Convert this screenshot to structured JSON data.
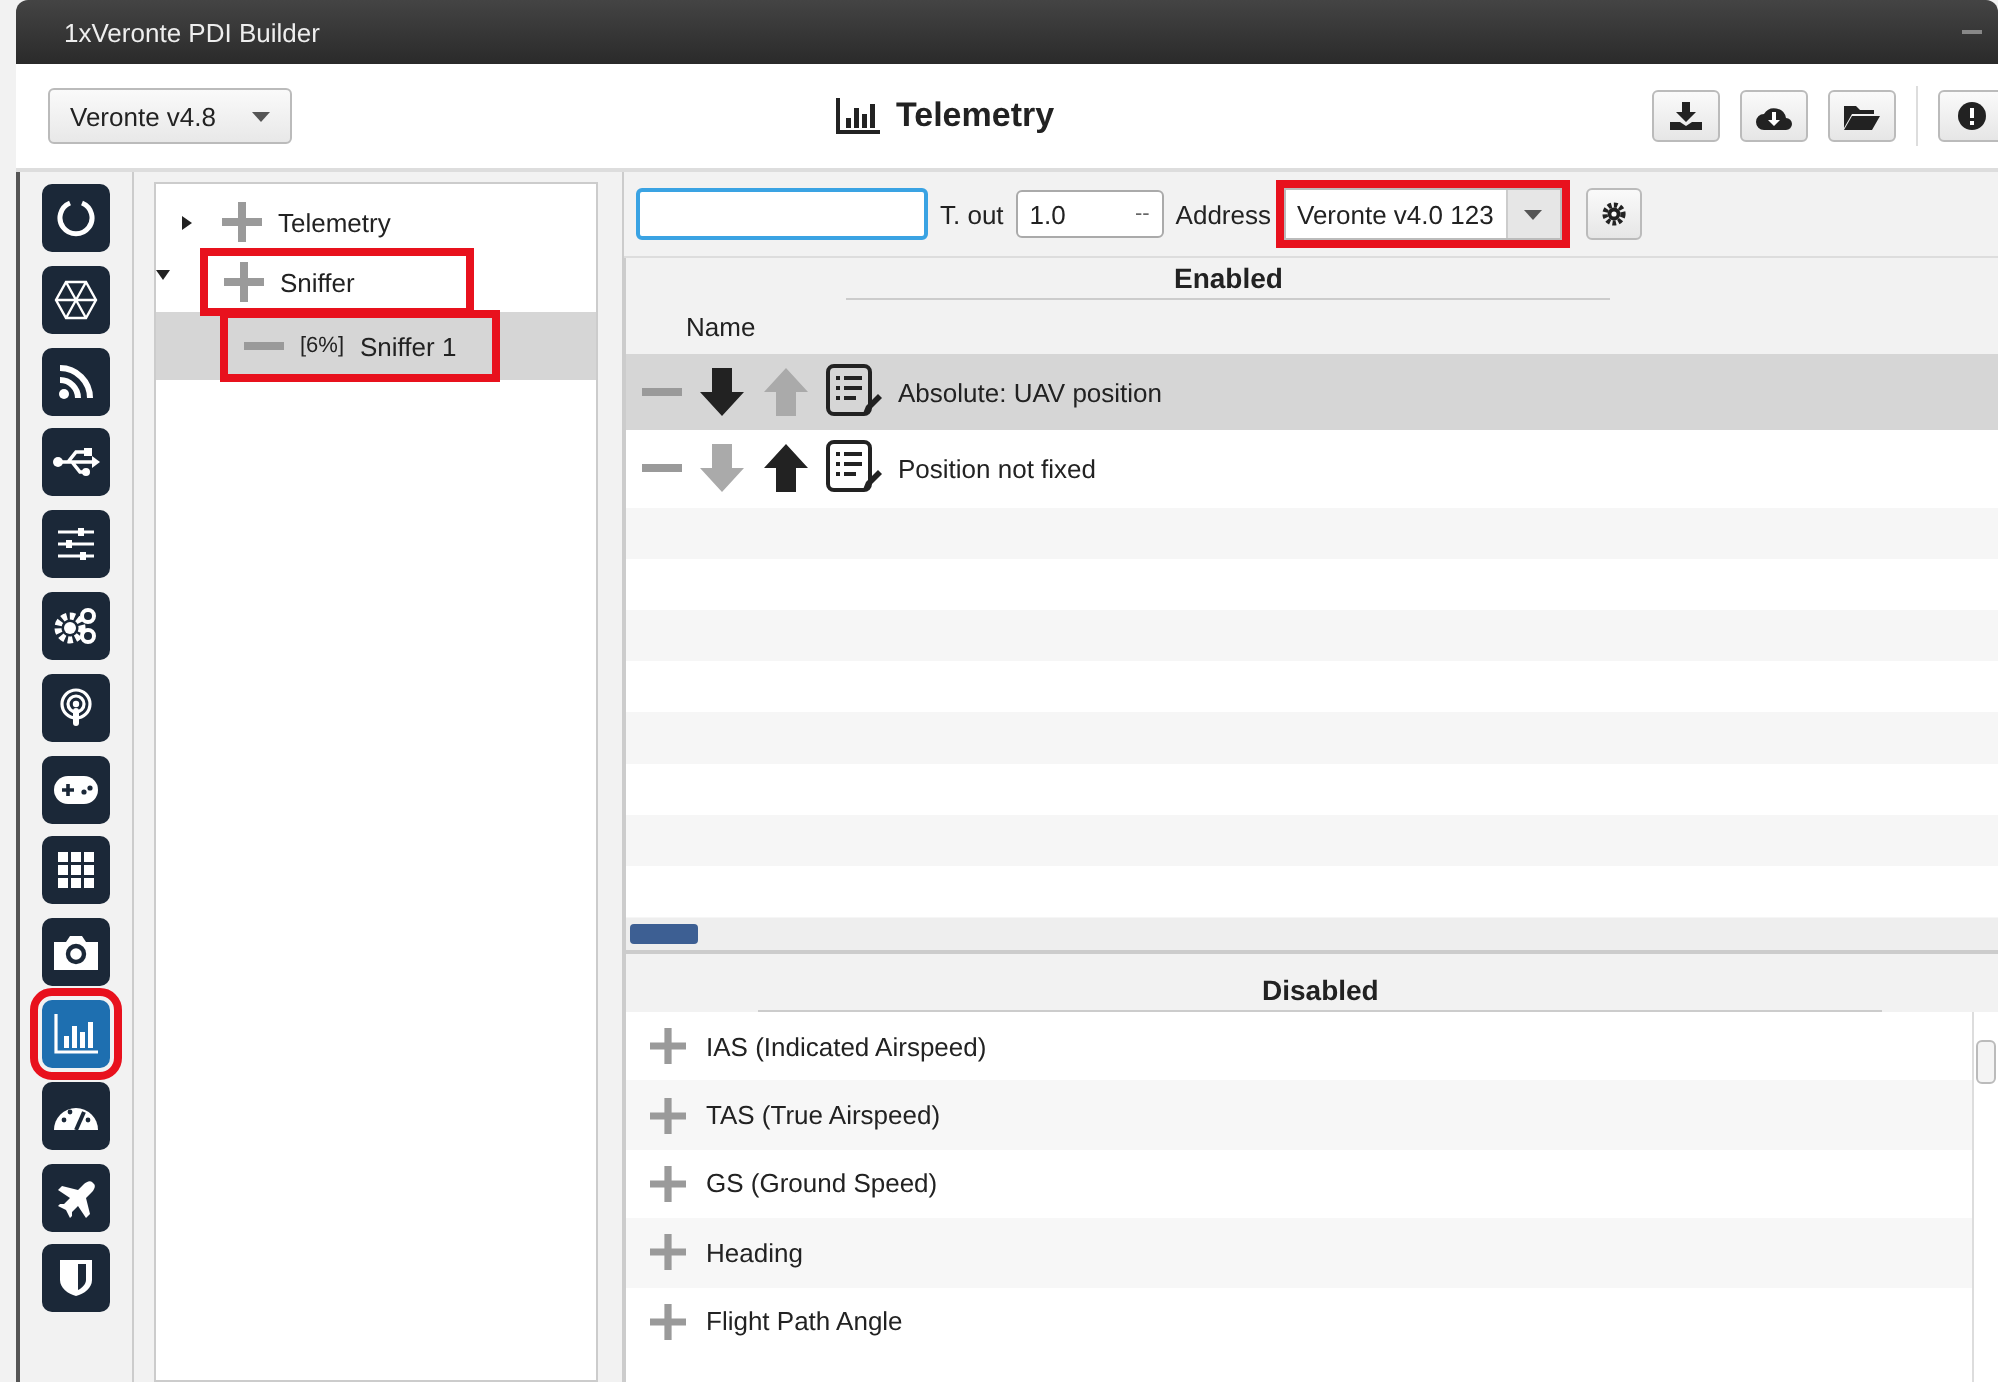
{
  "window": {
    "title": "1xVeronte PDI Builder"
  },
  "toolbar": {
    "version_select": "Veronte v4.8",
    "caption": "Telemetry"
  },
  "sidebar": {
    "items": [
      {
        "kind": "ring",
        "selected": false,
        "highlighted": false
      },
      {
        "kind": "hexagon",
        "selected": false,
        "highlighted": false
      },
      {
        "kind": "signal",
        "selected": false,
        "highlighted": false
      },
      {
        "kind": "usb",
        "selected": false,
        "highlighted": false
      },
      {
        "kind": "sliders",
        "selected": false,
        "highlighted": false
      },
      {
        "kind": "gears",
        "selected": false,
        "highlighted": false
      },
      {
        "kind": "broadcast",
        "selected": false,
        "highlighted": false
      },
      {
        "kind": "gamepad",
        "selected": false,
        "highlighted": false
      },
      {
        "kind": "grid",
        "selected": false,
        "highlighted": false
      },
      {
        "kind": "camera",
        "selected": false,
        "highlighted": false
      },
      {
        "kind": "chart",
        "selected": true,
        "highlighted": true
      },
      {
        "kind": "gauge",
        "selected": false,
        "highlighted": false
      },
      {
        "kind": "plane",
        "selected": false,
        "highlighted": false
      },
      {
        "kind": "shield",
        "selected": false,
        "highlighted": false
      }
    ]
  },
  "tree": {
    "items": [
      {
        "label": "Telemetry",
        "expanded": false,
        "highlighted": false
      },
      {
        "label": "Sniffer",
        "expanded": true,
        "highlighted": true,
        "children": [
          {
            "badge": "[6%]",
            "label": "Sniffer 1",
            "selected": true,
            "highlighted": true
          }
        ]
      }
    ]
  },
  "filter": {
    "timeout_label": "T. out",
    "timeout_value": "1.0",
    "timeout_unit": "--",
    "address_label": "Address",
    "address_value": "Veronte v4.0 123",
    "address_highlighted": true
  },
  "enabled": {
    "title": "Enabled",
    "column": "Name",
    "rows": [
      {
        "label": "Absolute: UAV position",
        "selected": true,
        "down_enabled": true,
        "up_enabled": false
      },
      {
        "label": "Position not fixed",
        "selected": false,
        "down_enabled": false,
        "up_enabled": true
      }
    ]
  },
  "disabled": {
    "title": "Disabled",
    "rows": [
      {
        "label": "IAS (Indicated Airspeed)"
      },
      {
        "label": "TAS (True Airspeed)"
      },
      {
        "label": "GS (Ground Speed)"
      },
      {
        "label": "Heading"
      },
      {
        "label": "Flight Path Angle"
      }
    ]
  }
}
